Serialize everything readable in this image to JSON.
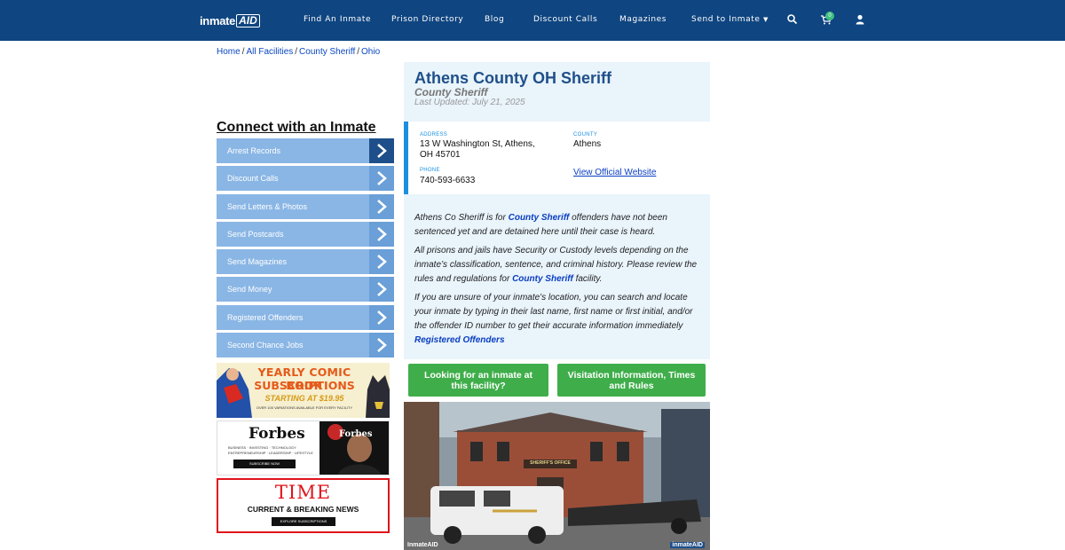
{
  "brand": {
    "logo_text": "inmate",
    "logo_box": "AID"
  },
  "nav": {
    "items": [
      "Find An Inmate",
      "Prison Directory",
      "Blog",
      "Discount Calls",
      "Magazines",
      "Send to Inmate"
    ],
    "cart_count": "0",
    "icons": [
      "search-icon",
      "cart-icon",
      "user-icon"
    ]
  },
  "breadcrumb": [
    "Home",
    "All Facilities",
    "County Sheriff",
    "Ohio"
  ],
  "sidebar": {
    "title": "Connect with an Inmate",
    "items": [
      "Arrest Records",
      "Discount Calls",
      "Send Letters & Photos",
      "Send Postcards",
      "Send Magazines",
      "Send Money",
      "Registered Offenders",
      "Second Chance Jobs"
    ]
  },
  "ads": {
    "comic": {
      "line1": "YEARLY COMIC BOOK",
      "line2": "SUBSCRIPTIONS",
      "line3": "STARTING AT $19.95",
      "line4": "OVER 100 VARIATIONS AVAILABLE FOR EVERY FACILITY"
    },
    "forbes": {
      "title": "Forbes",
      "line1": "BUSINESS · INVESTING · TECHNOLOGY",
      "line2": "ENTREPRENEURSHIP · LEADERSHIP · LIFESTYLE",
      "button": "SUBSCRIBE NOW",
      "cover_title": "Forbes"
    },
    "time": {
      "title": "TIME",
      "subtitle": "CURRENT & BREAKING NEWS",
      "button": "EXPLORE SUBSCRIPTIONS"
    }
  },
  "facility": {
    "name": "Athens County OH Sheriff",
    "type": "County Sheriff",
    "updated": "Last Updated: July 21, 2025",
    "address_label": "ADDRESS",
    "address_line1": "13 W Washington St, Athens,",
    "address_line2": "OH 45701",
    "county_label": "COUNTY",
    "county": "Athens",
    "phone_label": "PHONE",
    "phone": "740-593-6633",
    "website_link": "View Official Website"
  },
  "description": {
    "p1_pre": "Athens Co Sheriff is for ",
    "p1_link": "County Sheriff",
    "p1_post": " offenders have not been sentenced yet and are detained here until their case is heard.",
    "p2_pre": "All prisons and jails have Security or Custody levels depending on the inmate’s classification, sentence, and criminal history. Please review the rules and regulations for ",
    "p2_link": "County Sheriff",
    "p2_post": " facility.",
    "p3_pre": "If you are unsure of your inmate's location, you can search and locate your inmate by typing in their last name, first name or first initial, and/or the offender ID number to get their accurate information immediately ",
    "p3_link": "Registered Offenders"
  },
  "buttons": {
    "look": "Looking for an inmate at this facility?",
    "visit": "Visitation Information, Times and Rules"
  },
  "photo": {
    "sign": "SHERIFF'S OFFICE",
    "watermark_left": "InmateAID",
    "watermark_right": "inmateAID"
  }
}
